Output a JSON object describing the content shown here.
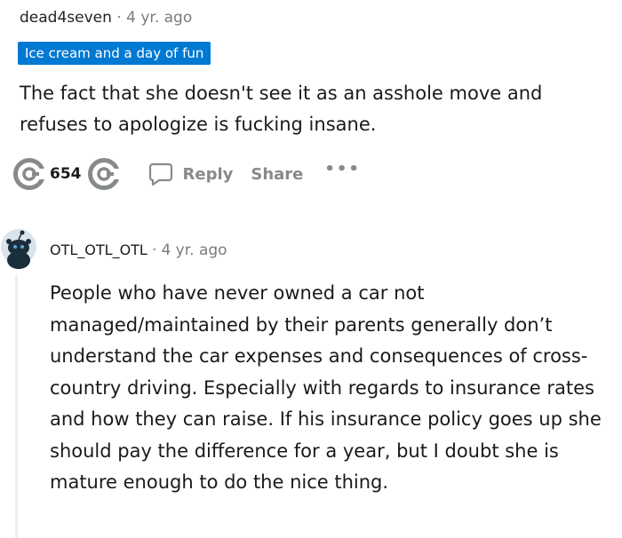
{
  "comments": [
    {
      "author": "dead4seven",
      "separator": "·",
      "time": "4 yr. ago",
      "flair": "Ice cream and a day of fun",
      "body": "The fact that she doesn't see it as an asshole move and refuses to apologize is fucking insane.",
      "votes": "654",
      "actions": {
        "reply": "Reply",
        "share": "Share",
        "more": "•••"
      }
    },
    {
      "author": "OTL_OTL_OTL",
      "separator": "·",
      "time": "4 yr. ago",
      "body": "People who have never owned a car not managed/maintained by their parents generally don’t understand the car expenses and consequences of cross-country driving. Especially with regards to insurance rates and how they can raise. If his insurance policy goes up she should pay the difference for a year, but I doubt she is mature enough to do the nice thing."
    }
  ],
  "colors": {
    "flair_bg": "#0079d3",
    "action_text": "#878a8c",
    "thread_line": "#edeff1"
  },
  "icons": {
    "upvote": "upvote-icon",
    "downvote": "downvote-icon",
    "reply": "comment-bubble-icon",
    "avatar": "snoo-avatar-icon"
  }
}
